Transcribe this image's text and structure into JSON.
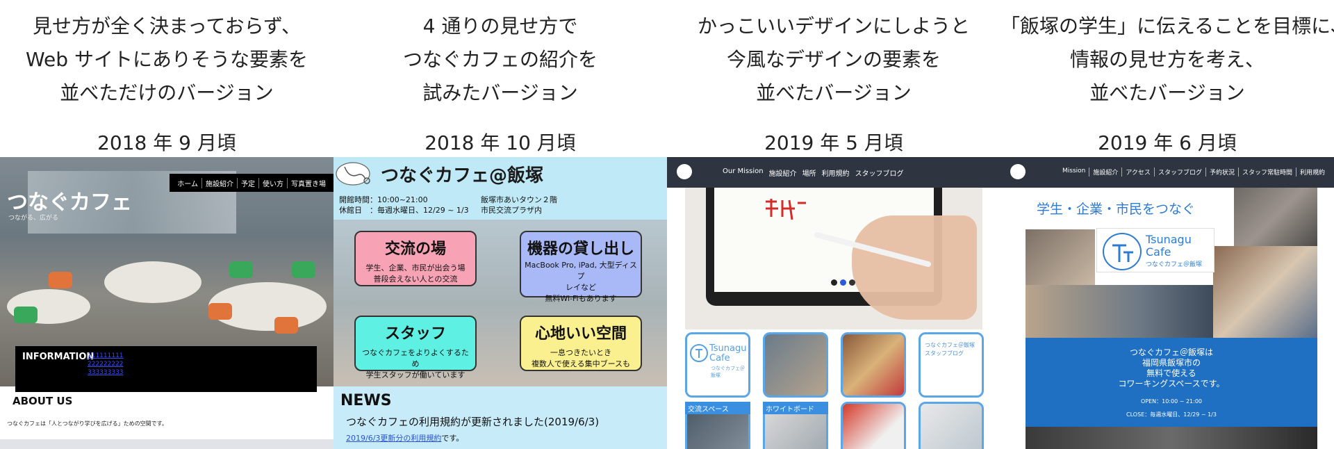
{
  "columns": [
    {
      "caption": [
        "見せ方が全く決まっておらず、",
        "Web サイトにありそうな要素を",
        "並べただけのバージョン"
      ],
      "date": "2018 年 9 月頃"
    },
    {
      "caption": [
        "4 通りの見せ方で",
        "つなぐカフェの紹介を",
        "試みたバージョン"
      ],
      "date": "2018 年 10 月頃"
    },
    {
      "caption": [
        "かっこいいデザインにしようと",
        "今風なデザインの要素を",
        "並べたバージョン"
      ],
      "date": "2019 年 5 月頃"
    },
    {
      "caption": [
        "「飯塚の学生」に伝えることを目標に、",
        "情報の見せ方を考え、",
        "並べたバージョン"
      ],
      "date": "2019 年 6 月頃"
    }
  ],
  "shot1": {
    "nav": [
      "ホーム",
      "施設紹介",
      "予定",
      "使い方",
      "写真置き場"
    ],
    "title": "つなぐカフェ",
    "subtitle": "つながる、広がる",
    "info_heading": "INFORMATION",
    "info_links": [
      "111111111",
      "222222222",
      "333333333"
    ],
    "about_heading": "ABOUT US",
    "about_text": "つなぐカフェは「人とつながり学びを広げる」ための空間です。"
  },
  "shot2": {
    "title": "つなぐカフェ@飯塚",
    "hours": "開館時間：10:00~21:00",
    "closed": "休館日　：毎週水曜日、12/29 ~ 1/3",
    "address1": "飯塚市あいタウン２階",
    "address2": "市民交流プラザ内",
    "cards": [
      {
        "title": "交流の場",
        "lines": [
          "学生、企業、市民が出会う場",
          "普段会えない人との交流"
        ],
        "color": "#f7a3b5"
      },
      {
        "title": "機器の貸し出し",
        "lines": [
          "MacBook Pro, iPad, 大型ディスプ",
          "レイなど",
          "無料Wi-Fiもあります"
        ],
        "color": "#a9b8f7"
      },
      {
        "title": "スタッフ",
        "lines": [
          "つなぐカフェをよりよくするため",
          "学生スタッフが働いています"
        ],
        "color": "#5ef0e3"
      },
      {
        "title": "心地いい空間",
        "lines": [
          "一息つきたいとき",
          "複数人で使える集中ブースも"
        ],
        "color": "#fbf08f"
      }
    ],
    "news_heading": "NEWS",
    "news_title": "つなぐカフェの利用規約が更新されました(2019/6/3)",
    "news_link": "2019/6/3更新分の利用規約",
    "news_suffix": "です。"
  },
  "shot3": {
    "nav": [
      "Our Mission",
      "施設紹介",
      "場所",
      "利用規約",
      "スタッフブログ"
    ],
    "tile_logo1": "Tsunagu",
    "tile_logo2": "Cafe",
    "tile_logo3": "つなぐカフェ＠飯塚",
    "tile_blog": "つなぐカフェ＠飯塚 スタッフブログ",
    "labels": [
      "交流スペース",
      "ホワイトボード"
    ]
  },
  "shot4": {
    "nav": [
      "Mission",
      "施設紹介",
      "アクセス",
      "スタッフブログ",
      "予約状況",
      "スタッフ常駐時間",
      "利用規約"
    ],
    "slogan": "学生・企業・市民をつなぐ",
    "logo1": "Tsunagu",
    "logo2": "Cafe",
    "logo3": "つなぐカフェ＠飯塚",
    "message": [
      "つなぐカフェ＠飯塚は",
      "福岡県飯塚市の",
      "無料で使える",
      "コワーキングスペースです。"
    ],
    "open": "OPEN：10:00 ~ 21:00",
    "close": "CLOSE：毎週水曜日、12/29 ~ 1/3"
  }
}
